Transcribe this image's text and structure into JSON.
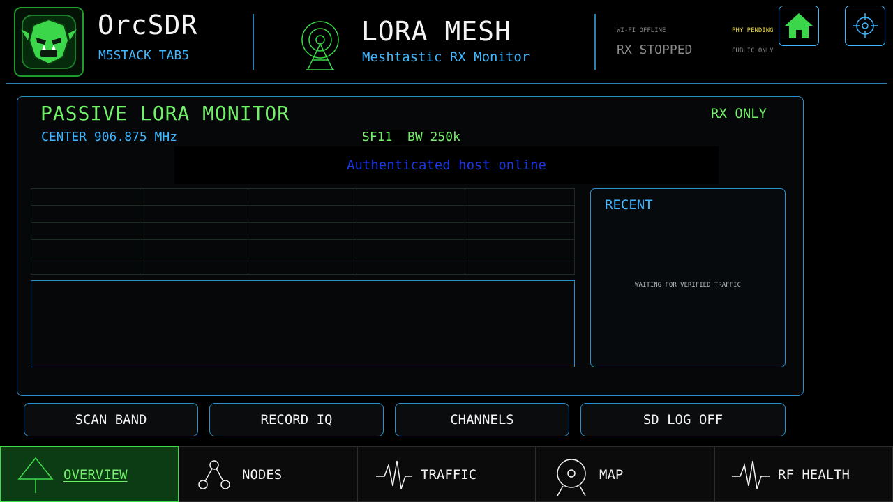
{
  "header": {
    "app_title": "OrcSDR",
    "app_subtitle": "M5STACK TAB5",
    "mode_title": "LORA MESH",
    "mode_subtitle": "Meshtastic RX Monitor",
    "wifi_status": "WI-FI OFFLINE",
    "phy_status": "PHY PENDING",
    "rx_status": "RX STOPPED",
    "access_status": "PUBLIC ONLY",
    "home_icon": "home-icon",
    "target_icon": "crosshair-icon"
  },
  "panel": {
    "title": "PASSIVE LORA MONITOR",
    "rx_mode": "RX ONLY",
    "center_freq": "CENTER 906.875 MHz",
    "sf_bw": "SF11  BW 250k",
    "auth_message": "Authenticated host online",
    "recent_title": "RECENT",
    "recent_empty": "WAITING FOR VERIFIED TRAFFIC"
  },
  "actions": [
    {
      "label": "SCAN BAND"
    },
    {
      "label": "RECORD IQ"
    },
    {
      "label": "CHANNELS"
    },
    {
      "label": "SD LOG OFF"
    }
  ],
  "nav": [
    {
      "label": "OVERVIEW",
      "icon": "overview-tree-icon",
      "active": true
    },
    {
      "label": "NODES",
      "icon": "nodes-icon",
      "active": false
    },
    {
      "label": "TRAFFIC",
      "icon": "waveform-icon",
      "active": false
    },
    {
      "label": "MAP",
      "icon": "map-pin-icon",
      "active": false
    },
    {
      "label": "RF HEALTH",
      "icon": "waveform-icon",
      "active": false
    }
  ],
  "colors": {
    "accent_green": "#73f06a",
    "accent_blue": "#3fb6ff",
    "warning_yellow": "#e8d23a",
    "auth_blue": "#1a36e6"
  }
}
